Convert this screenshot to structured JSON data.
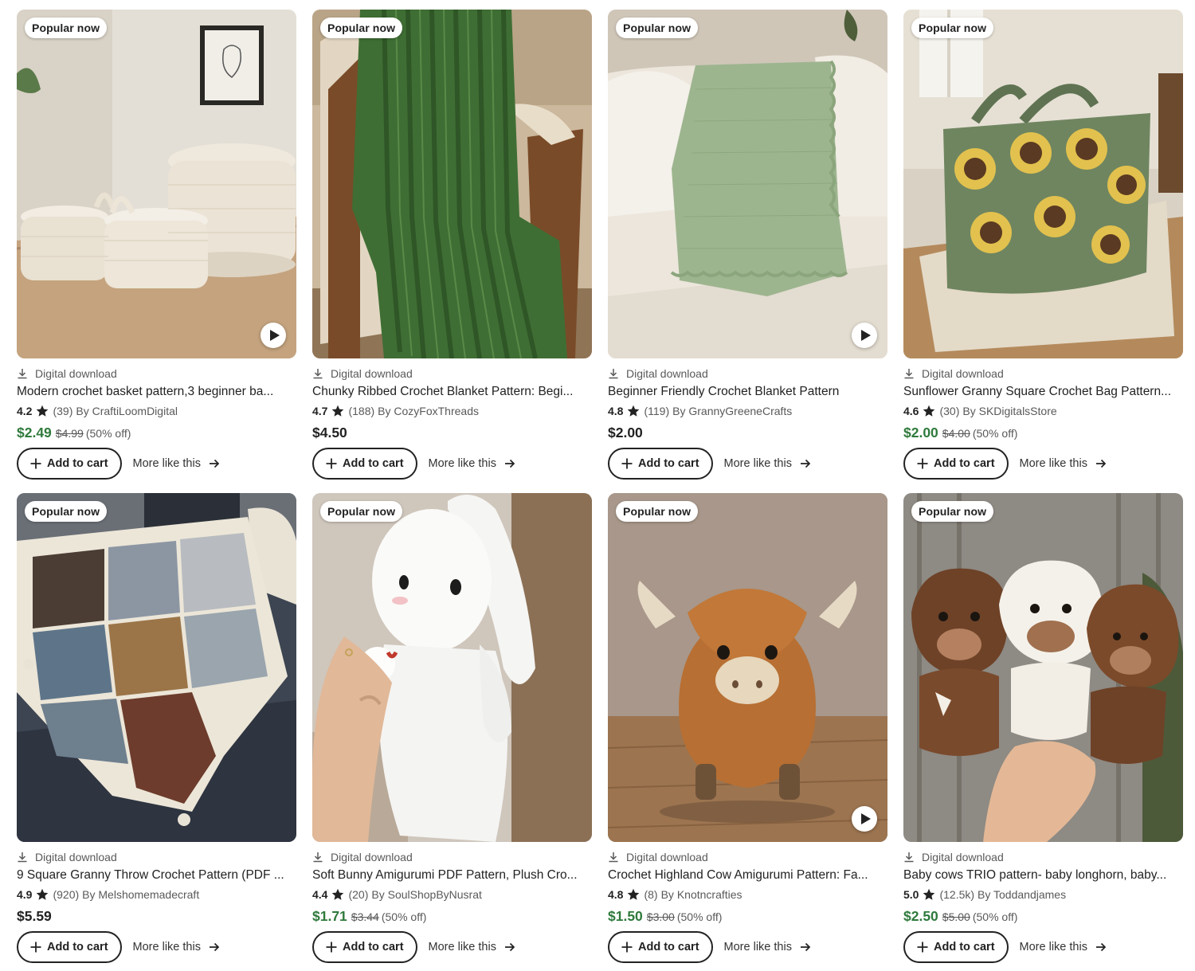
{
  "labels": {
    "badge": "Popular now",
    "download": "Digital download",
    "add_to_cart": "Add to cart",
    "more_like_this": "More like this"
  },
  "icons": {
    "download": "download-icon",
    "star": "star-icon",
    "plus": "plus-icon",
    "arrow": "arrow-right-icon",
    "play": "play-icon"
  },
  "colors": {
    "sale_price": "#2f7a3c",
    "text": "#222222",
    "muted": "#595959"
  },
  "products": [
    {
      "image": "crochet-baskets",
      "title": "Modern crochet basket pattern,3 beginner ba...",
      "rating": "4.2",
      "reviews": "(39)",
      "by": "By CraftiLoomDigital",
      "price": "$2.49",
      "original_price": "$4.99",
      "discount": "(50% off)",
      "has_video": true
    },
    {
      "image": "green-ribbed-blanket",
      "title": "Chunky Ribbed Crochet Blanket Pattern: Begi...",
      "rating": "4.7",
      "reviews": "(188)",
      "by": "By CozyFoxThreads",
      "price": "$4.50",
      "original_price": "",
      "discount": "",
      "has_video": false
    },
    {
      "image": "sage-blanket",
      "title": "Beginner Friendly Crochet Blanket Pattern",
      "rating": "4.8",
      "reviews": "(119)",
      "by": "By GrannyGreeneCrafts",
      "price": "$2.00",
      "original_price": "",
      "discount": "",
      "has_video": true
    },
    {
      "image": "sunflower-bag",
      "title": "Sunflower Granny Square Crochet Bag Pattern...",
      "rating": "4.6",
      "reviews": "(30)",
      "by": "By SKDigitalsStore",
      "price": "$2.00",
      "original_price": "$4.00",
      "discount": "(50% off)",
      "has_video": false
    },
    {
      "image": "granny-square-throw",
      "title": "9 Square Granny Throw Crochet Pattern (PDF ...",
      "rating": "4.9",
      "reviews": "(920)",
      "by": "By Melshomemadecraft",
      "price": "$5.59",
      "original_price": "",
      "discount": "",
      "has_video": false
    },
    {
      "image": "white-bunny",
      "title": "Soft Bunny Amigurumi PDF Pattern, Plush Cro...",
      "rating": "4.4",
      "reviews": "(20)",
      "by": "By SoulShopByNusrat",
      "price": "$1.71",
      "original_price": "$3.44",
      "discount": "(50% off)",
      "has_video": false
    },
    {
      "image": "highland-cow",
      "title": "Crochet Highland Cow Amigurumi Pattern: Fa...",
      "rating": "4.8",
      "reviews": "(8)",
      "by": "By Knotncrafties",
      "price": "$1.50",
      "original_price": "$3.00",
      "discount": "(50% off)",
      "has_video": true
    },
    {
      "image": "baby-cows-trio",
      "title": "Baby cows TRIO pattern- baby longhorn, baby...",
      "rating": "5.0",
      "reviews": "(12.5k)",
      "by": "By Toddandjames",
      "price": "$2.50",
      "original_price": "$5.00",
      "discount": "(50% off)",
      "has_video": false
    }
  ]
}
